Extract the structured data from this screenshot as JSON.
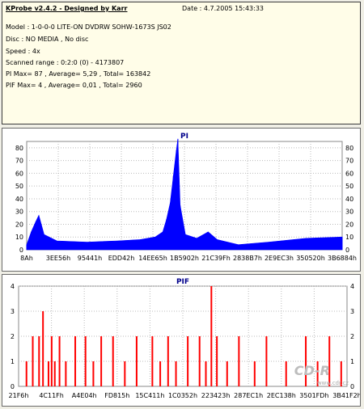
{
  "info": {
    "title": "KProbe v2.4.2 - Designed by Karr",
    "date": "Date : 4.7.2005 15:43:33",
    "model": "Model : 1-0-0-0 LITE-ON DVDRW SOHW-1673S JS02",
    "disc": "Disc : NO MEDIA , No disc",
    "speed": "Speed : 4x",
    "scanned": "Scanned range : 0:2:0 (0) - 4173807",
    "pi_stats": "PI Max= 87 , Average= 5,29 , Total= 163842",
    "pif_stats": "PIF Max= 4 , Average= 0,01 , Total= 2960"
  },
  "watermark": {
    "logo": "CD-R",
    "url": "www.cdr.cz"
  },
  "colors": {
    "pi": "#0000ff",
    "pif": "#ff0000",
    "title": "#00008b"
  },
  "chart_data": [
    {
      "type": "area",
      "title": "PI",
      "ylim": [
        0,
        85
      ],
      "yticks": [
        0,
        10,
        20,
        30,
        40,
        50,
        60,
        70,
        80
      ],
      "grid": true,
      "tick_labels": [
        "8Ah",
        "3EE56h",
        "95441h",
        "EDD42h",
        "14EE65h",
        "1B5902h",
        "21C39Fh",
        "2838B7h",
        "2E9EC3h",
        "350520h",
        "3B6884h"
      ],
      "x_range": [
        0,
        4173807
      ],
      "values_approx": [
        {
          "x": 0,
          "y": 4
        },
        {
          "x": 60000,
          "y": 14
        },
        {
          "x": 120000,
          "y": 22
        },
        {
          "x": 160000,
          "y": 27
        },
        {
          "x": 230000,
          "y": 12
        },
        {
          "x": 400000,
          "y": 7
        },
        {
          "x": 800000,
          "y": 6
        },
        {
          "x": 1200000,
          "y": 7
        },
        {
          "x": 1500000,
          "y": 8
        },
        {
          "x": 1700000,
          "y": 10
        },
        {
          "x": 1800000,
          "y": 14
        },
        {
          "x": 1850000,
          "y": 24
        },
        {
          "x": 1900000,
          "y": 37
        },
        {
          "x": 1940000,
          "y": 58
        },
        {
          "x": 1980000,
          "y": 78
        },
        {
          "x": 2000000,
          "y": 87
        },
        {
          "x": 2030000,
          "y": 35
        },
        {
          "x": 2100000,
          "y": 12
        },
        {
          "x": 2250000,
          "y": 9
        },
        {
          "x": 2400000,
          "y": 14
        },
        {
          "x": 2520000,
          "y": 8
        },
        {
          "x": 2800000,
          "y": 4
        },
        {
          "x": 3200000,
          "y": 6
        },
        {
          "x": 3700000,
          "y": 9
        },
        {
          "x": 4173807,
          "y": 10
        }
      ]
    },
    {
      "type": "bar",
      "title": "PIF",
      "ylim": [
        0,
        4
      ],
      "yticks": [
        0,
        1,
        2,
        3,
        4
      ],
      "grid": true,
      "tick_labels": [
        "21F6h",
        "4C11Fh",
        "A4E04h",
        "FD815h",
        "15C411h",
        "1C0352h",
        "223423h",
        "287EC1h",
        "2EC138h",
        "3501FDh",
        "3B41F2h"
      ],
      "x_range": [
        0,
        4173807
      ],
      "values_approx": [
        {
          "x": 100000,
          "y": 1
        },
        {
          "x": 180000,
          "y": 2
        },
        {
          "x": 260000,
          "y": 2
        },
        {
          "x": 310000,
          "y": 3
        },
        {
          "x": 380000,
          "y": 1
        },
        {
          "x": 420000,
          "y": 2
        },
        {
          "x": 460000,
          "y": 1
        },
        {
          "x": 520000,
          "y": 2
        },
        {
          "x": 600000,
          "y": 1
        },
        {
          "x": 720000,
          "y": 2
        },
        {
          "x": 850000,
          "y": 2
        },
        {
          "x": 950000,
          "y": 1
        },
        {
          "x": 1050000,
          "y": 2
        },
        {
          "x": 1200000,
          "y": 2
        },
        {
          "x": 1350000,
          "y": 1
        },
        {
          "x": 1500000,
          "y": 2
        },
        {
          "x": 1700000,
          "y": 2
        },
        {
          "x": 1800000,
          "y": 1
        },
        {
          "x": 1900000,
          "y": 2
        },
        {
          "x": 2000000,
          "y": 1
        },
        {
          "x": 2150000,
          "y": 2
        },
        {
          "x": 2300000,
          "y": 2
        },
        {
          "x": 2380000,
          "y": 1
        },
        {
          "x": 2450000,
          "y": 4
        },
        {
          "x": 2520000,
          "y": 2
        },
        {
          "x": 2650000,
          "y": 1
        },
        {
          "x": 2800000,
          "y": 2
        },
        {
          "x": 3000000,
          "y": 1
        },
        {
          "x": 3150000,
          "y": 2
        },
        {
          "x": 3400000,
          "y": 1
        },
        {
          "x": 3650000,
          "y": 2
        },
        {
          "x": 3800000,
          "y": 1
        },
        {
          "x": 3950000,
          "y": 2
        },
        {
          "x": 4100000,
          "y": 1
        }
      ]
    }
  ]
}
